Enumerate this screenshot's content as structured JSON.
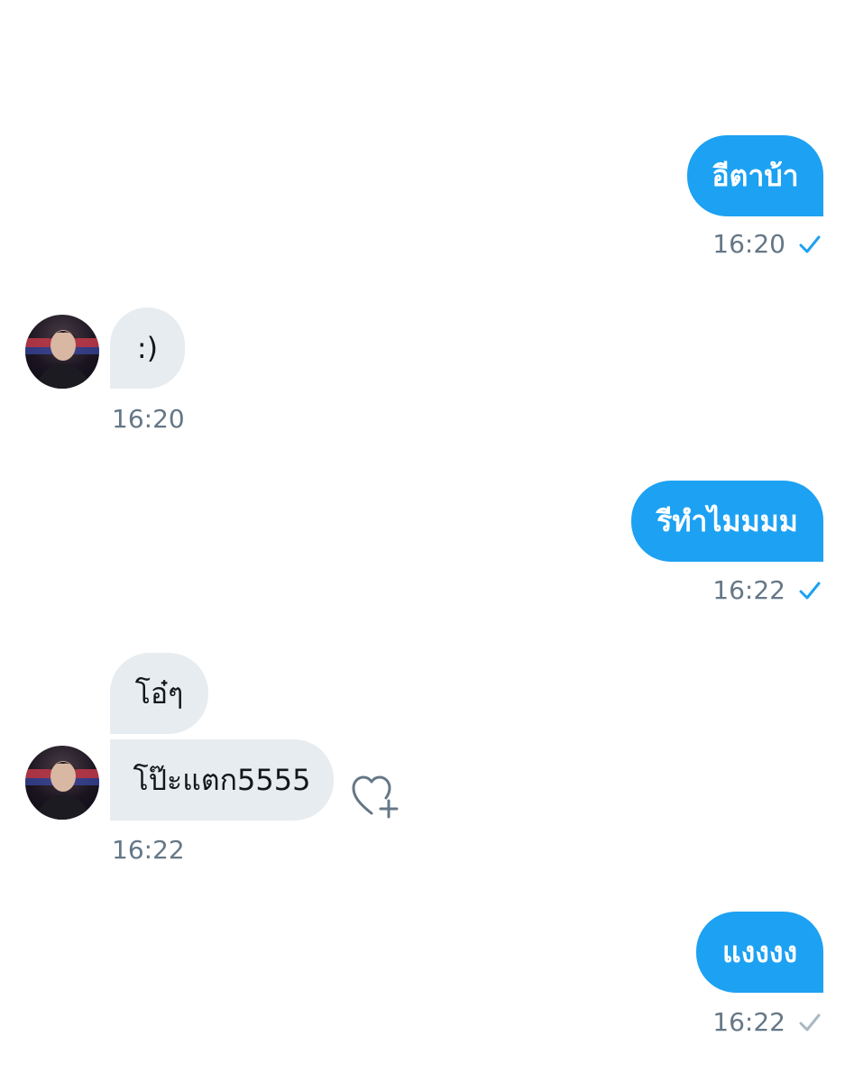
{
  "conversation": {
    "messages": [
      {
        "text": "อีตาบ้า",
        "time": "16:20",
        "direction": "outgoing",
        "status": "read"
      },
      {
        "text": ":)",
        "time": "16:20",
        "direction": "incoming"
      },
      {
        "text": "รีทำไมมมม",
        "time": "16:22",
        "direction": "outgoing",
        "status": "read"
      },
      {
        "text": "โอ๋ๆ",
        "time": "",
        "direction": "incoming"
      },
      {
        "text": "โป๊ะแตก5555",
        "time": "16:22",
        "direction": "incoming"
      },
      {
        "text": "แงงงง",
        "time": "16:22",
        "direction": "outgoing",
        "status": "sent"
      }
    ]
  },
  "icons": {
    "read_check": "check-icon",
    "sent_check": "check-icon",
    "react": "heart-plus-icon"
  },
  "colors": {
    "outgoing_bubble": "#1da1f2",
    "incoming_bubble": "#e6ecf0",
    "timestamp": "#657786",
    "read_check": "#1da1f2",
    "sent_check": "#aab8c2"
  }
}
